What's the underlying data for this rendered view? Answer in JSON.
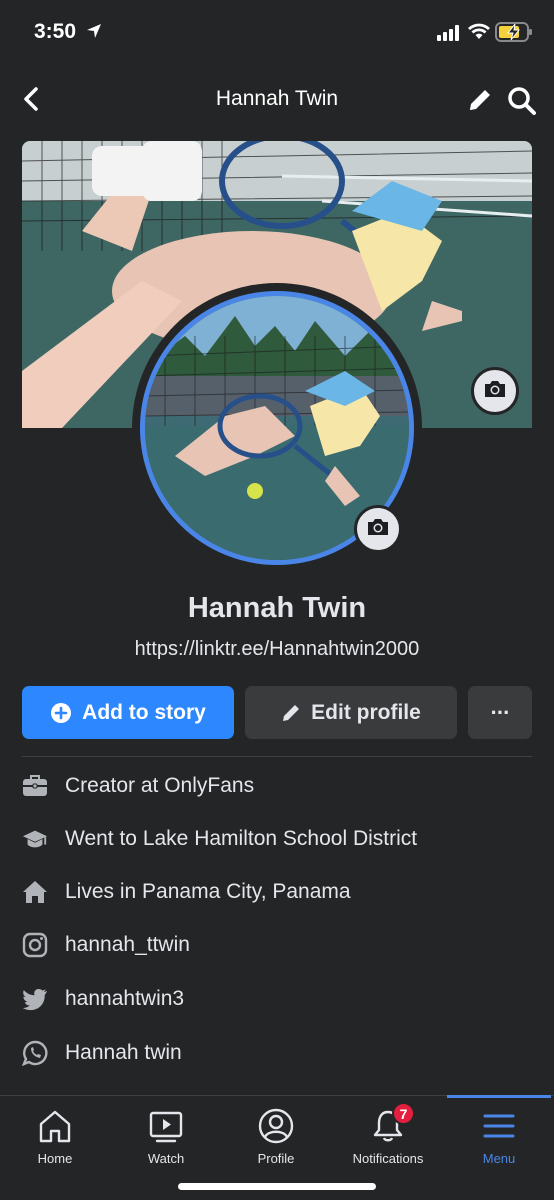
{
  "status_bar": {
    "time": "3:50",
    "icons": [
      "location-arrow-icon",
      "cellular-signal-icon",
      "wifi-icon",
      "battery-charging-icon"
    ]
  },
  "header": {
    "title": "Hannah Twin",
    "back_icon": "chevron-left-icon",
    "edit_icon": "pencil-icon",
    "search_icon": "search-icon"
  },
  "profile": {
    "name": "Hannah Twin",
    "link": "https://linktr.ee/Hannahtwin2000"
  },
  "actions": {
    "add_story": "Add to story",
    "edit_profile": "Edit profile",
    "more": "···"
  },
  "info": [
    {
      "icon": "briefcase-icon",
      "prefix": "Creator at ",
      "value": "OnlyFans"
    },
    {
      "icon": "graduation-cap-icon",
      "prefix": "Went to ",
      "value": "Lake Hamilton School District"
    },
    {
      "icon": "house-icon",
      "prefix": "Lives in ",
      "value": "Panama City, Panama"
    },
    {
      "icon": "instagram-icon",
      "prefix": "",
      "value": "hannah_ttwin"
    },
    {
      "icon": "twitter-icon",
      "prefix": "",
      "value": "hannahtwin3"
    },
    {
      "icon": "whatsapp-icon",
      "prefix": "",
      "value": "Hannah twin"
    }
  ],
  "tabs": [
    {
      "label": "Home",
      "icon": "home-icon"
    },
    {
      "label": "Watch",
      "icon": "watch-video-icon"
    },
    {
      "label": "Profile",
      "icon": "profile-icon"
    },
    {
      "label": "Notifications",
      "icon": "bell-icon",
      "badge": "7"
    },
    {
      "label": "Menu",
      "icon": "hamburger-menu-icon",
      "active": true
    }
  ],
  "colors": {
    "background": "#242526",
    "accent": "#2d88ff",
    "active_tab": "#4a86e8",
    "badge": "#e41e3f"
  }
}
